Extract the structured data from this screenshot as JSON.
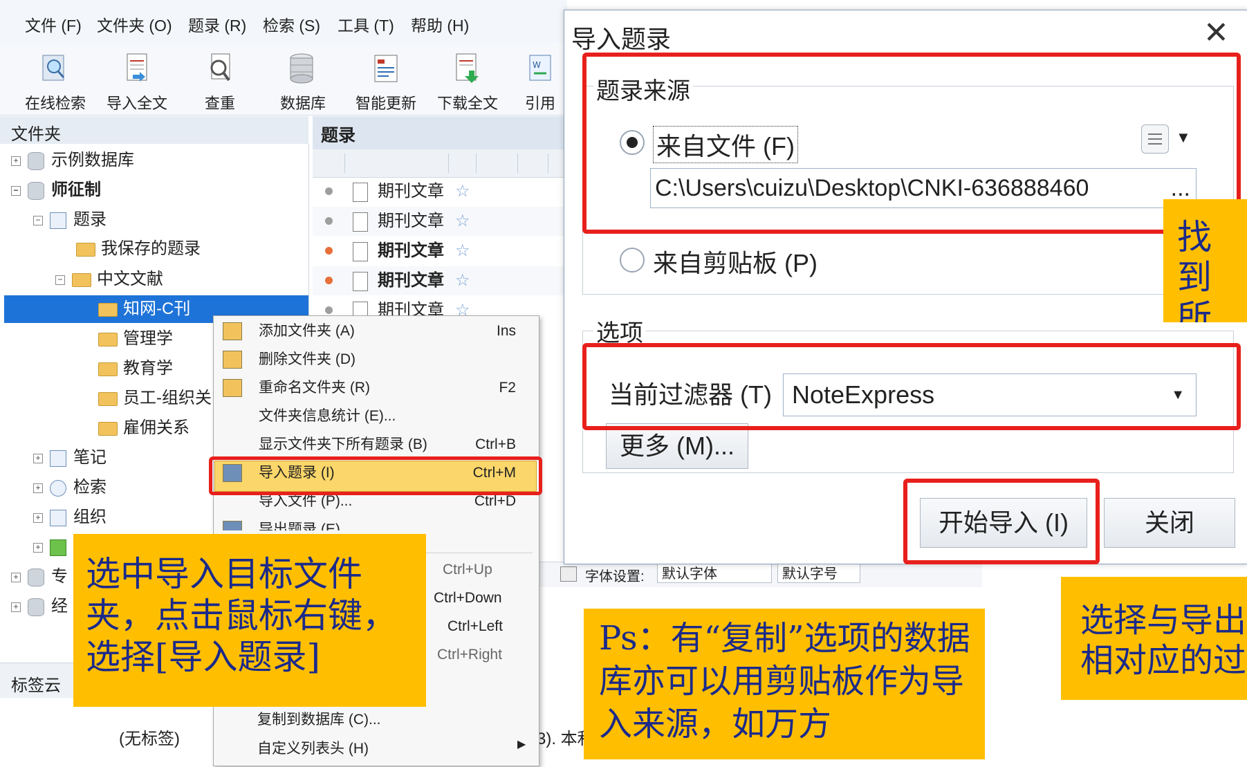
{
  "menubar": {
    "items": [
      "文件 (F)",
      "文件夹 (O)",
      "题录 (R)",
      "检索 (S)",
      "工具 (T)",
      "帮助 (H)"
    ]
  },
  "toolbar": {
    "buttons": [
      "在线检索",
      "导入全文",
      "查重",
      "数据库",
      "智能更新",
      "下载全文",
      "引用"
    ]
  },
  "folder_panel": {
    "header": "文件夹",
    "tree": [
      "示例数据库",
      "师征制",
      "题录",
      "我保存的题录",
      "中文文献",
      "知网-C刊",
      "管理学",
      "教育学",
      "员工-组织关",
      "雇佣关系",
      "笔记",
      "检索",
      "组织",
      "专",
      "经"
    ],
    "tag_header": "标签云",
    "no_tags": "(无标签)"
  },
  "ref_list": {
    "header": "题录",
    "rows": [
      "期刊文章",
      "期刊文章",
      "期刊文章",
      "期刊文章",
      "期刊文章"
    ],
    "dot_colors": [
      "#9e9e9e",
      "#9e9e9e",
      "#e8703a",
      "#e8703a",
      "#9e9e9e"
    ],
    "bold_rows": [
      false,
      false,
      true,
      true,
      false
    ]
  },
  "status_strip": {
    "font_label": "字体设置:",
    "font_value": "默认字体",
    "size_value": "默认字号",
    "tail_text": "3). 本利"
  },
  "context_menu": {
    "items": [
      {
        "label": "添加文件夹 (A)",
        "shortcut": "Ins"
      },
      {
        "label": "删除文件夹 (D)",
        "shortcut": ""
      },
      {
        "label": "重命名文件夹 (R)",
        "shortcut": "F2"
      },
      {
        "label": "文件夹信息统计 (E)...",
        "shortcut": ""
      },
      {
        "label": "显示文件夹下所有题录 (B)",
        "shortcut": "Ctrl+B"
      },
      {
        "label": "导入题录 (I)",
        "shortcut": "Ctrl+M"
      },
      {
        "label": "导入文件 (P)...",
        "shortcut": "Ctrl+D"
      },
      {
        "label": "导出题录 (E)",
        "shortcut": ""
      }
    ],
    "shortcuts_lower": [
      "Ctrl+Up",
      "Ctrl+Down",
      "Ctrl+Left",
      "Ctrl+Right"
    ],
    "bottom_items": [
      "复制到数据库 (C)...",
      "自定义列表头 (H)"
    ]
  },
  "dialog": {
    "title": "导入题录",
    "close_glyph": "✕",
    "source_group": "题录来源",
    "from_file": "来自文件 (F)",
    "file_path": "C:\\Users\\cuizu\\Desktop\\CNKI-636888460",
    "path_more": "...",
    "from_clipboard": "来自剪贴板 (P)",
    "options_group": "选项",
    "filter_label": "当前过滤器 (T)",
    "filter_value": "NoteExpress",
    "more_button": "更多 (M)...",
    "start_button": "开始导入 (I)",
    "close_button": "关闭"
  },
  "callouts": {
    "left": "选中导入目标文件夹，点击鼠标右键，选择[导入题录]",
    "ps": "Ps：有“复制”选项的数据库亦可以用剪贴板作为导入来源，如万方",
    "right_top": "找到所在",
    "right_bottom": "选择与导出相对应的过"
  },
  "colors": {
    "callout_bg": "#ffbf00",
    "callout_text": "#1b2a8a",
    "highlight_red": "#e8201c",
    "selected_blue": "#1e73d8"
  }
}
